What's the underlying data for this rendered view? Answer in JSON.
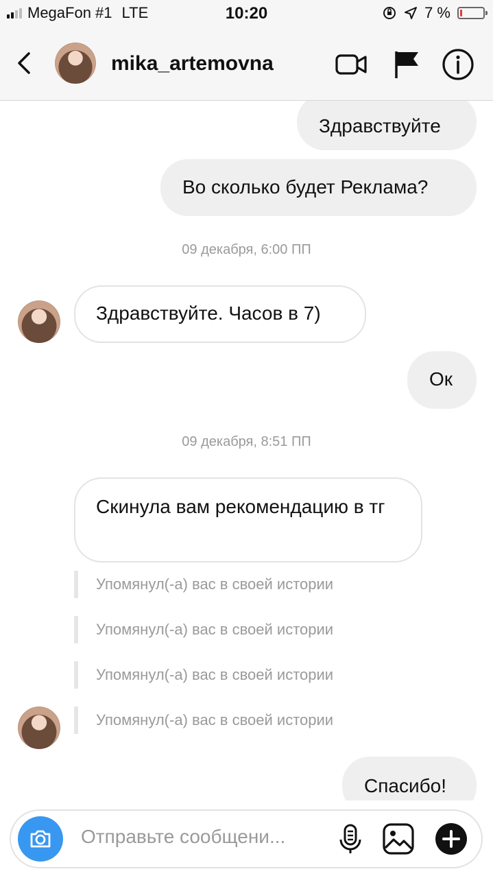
{
  "status_bar": {
    "carrier": "MegaFon #1",
    "network": "LTE",
    "time": "10:20",
    "battery": "7 %",
    "battery_level": 0.07
  },
  "header": {
    "username": "mika_artemovna",
    "icons": [
      "back-chevron-icon",
      "video-call-icon",
      "flag-icon",
      "info-icon"
    ]
  },
  "messages": {
    "m1": "Здравствуйте",
    "m2": "Во сколько будет Реклама?",
    "ts1": "09 декабря, 6:00 ПП",
    "m3": "Здравствуйте. Часов в 7)",
    "m4": "Ок",
    "ts2": "09 декабря, 8:51 ПП",
    "m5": "Скинула вам рекомендацию в тг",
    "mention": "Упомянул(-а) вас в своей истории",
    "m6": "Спасибо!"
  },
  "composer": {
    "placeholder": "Отправьте сообщени...",
    "icons": [
      "camera-icon",
      "microphone-icon",
      "gallery-icon",
      "plus-icon"
    ]
  },
  "colors": {
    "accent": "#3897f0",
    "outgoing_bubble": "#efefef",
    "battery_low": "#e53935"
  }
}
